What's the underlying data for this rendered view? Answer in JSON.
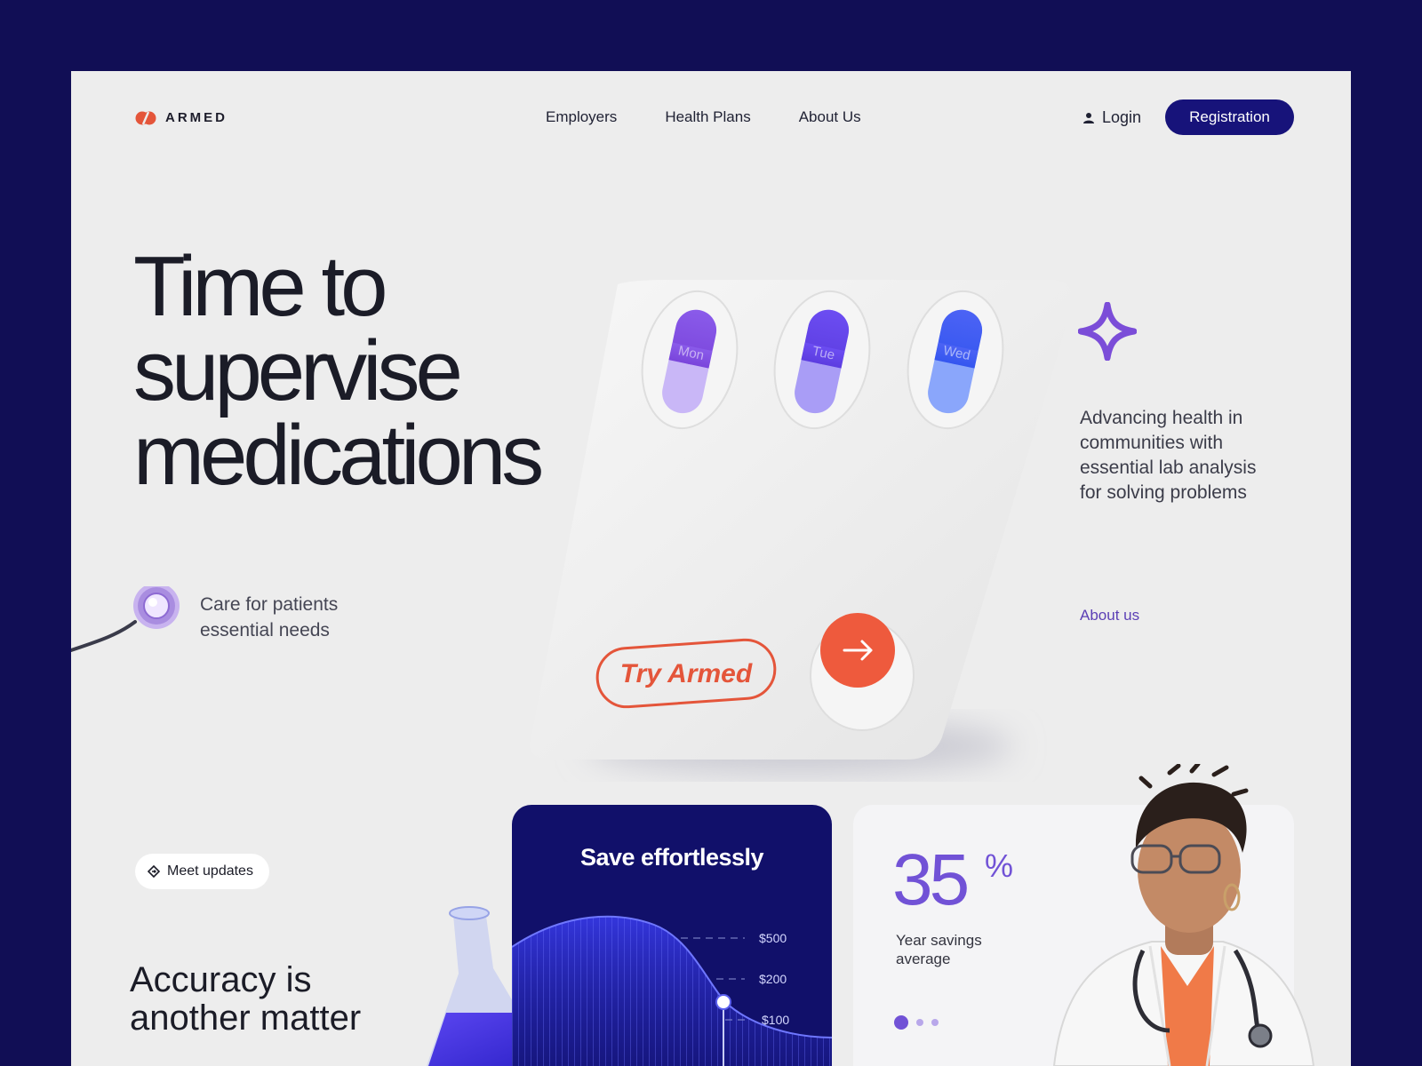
{
  "brand": {
    "name": "ARMED",
    "accent": "#e4553a",
    "primary": "#17137a",
    "purple": "#7152d6"
  },
  "nav": {
    "items": [
      "Employers",
      "Health Plans",
      "About Us"
    ]
  },
  "header": {
    "login": "Login",
    "registration": "Registration"
  },
  "hero": {
    "title_lines": [
      "Time to",
      "supervise",
      "medications"
    ],
    "care_text": "Care for patients essential needs",
    "blister_days": [
      "Mon",
      "Tue",
      "Wed"
    ],
    "cta_label": "Try Armed"
  },
  "aside": {
    "description": "Advancing health in communities with essential lab analysis for solving problems",
    "link": "About us"
  },
  "updates": {
    "pill": "Meet updates",
    "heading": "Accuracy is another matter"
  },
  "save_card": {
    "title": "Save effortlessly",
    "chart_data": {
      "type": "line",
      "title": "Save effortlessly",
      "tick_labels": [
        "$500",
        "$200",
        "$100"
      ]
    }
  },
  "stat_card": {
    "value": "35",
    "unit": "%",
    "label": "Year savings average",
    "dots_active": 0,
    "dots_total": 3
  },
  "icons": [
    "logo-mark-icon",
    "user-icon",
    "sparkle-star-icon",
    "arrow-right-icon",
    "diamond-arrow-icon",
    "stethoscope-icon",
    "flask-icon"
  ]
}
